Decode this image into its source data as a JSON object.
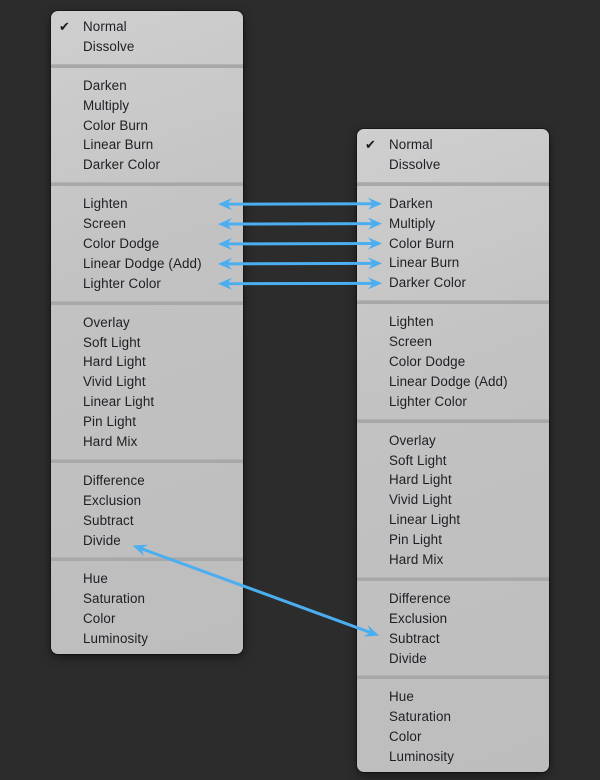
{
  "accent_color": "#4aaef0",
  "menus": [
    {
      "id": "left",
      "checked_item": "Normal",
      "groups": [
        [
          "Normal",
          "Dissolve"
        ],
        [
          "Darken",
          "Multiply",
          "Color Burn",
          "Linear Burn",
          "Darker Color"
        ],
        [
          "Lighten",
          "Screen",
          "Color Dodge",
          "Linear Dodge (Add)",
          "Lighter Color"
        ],
        [
          "Overlay",
          "Soft Light",
          "Hard Light",
          "Vivid Light",
          "Linear Light",
          "Pin Light",
          "Hard Mix"
        ],
        [
          "Difference",
          "Exclusion",
          "Subtract",
          "Divide"
        ],
        [
          "Hue",
          "Saturation",
          "Color",
          "Luminosity"
        ]
      ]
    },
    {
      "id": "right",
      "checked_item": "Normal",
      "groups": [
        [
          "Normal",
          "Dissolve"
        ],
        [
          "Darken",
          "Multiply",
          "Color Burn",
          "Linear Burn",
          "Darker Color"
        ],
        [
          "Lighten",
          "Screen",
          "Color Dodge",
          "Linear Dodge (Add)",
          "Lighter Color"
        ],
        [
          "Overlay",
          "Soft Light",
          "Hard Light",
          "Vivid Light",
          "Linear Light",
          "Pin Light",
          "Hard Mix"
        ],
        [
          "Difference",
          "Exclusion",
          "Subtract",
          "Divide"
        ],
        [
          "Hue",
          "Saturation",
          "Color",
          "Luminosity"
        ]
      ]
    }
  ],
  "mappings": [
    {
      "from": "Lighten",
      "to": "Darken",
      "style": "double-headed"
    },
    {
      "from": "Screen",
      "to": "Multiply",
      "style": "double-headed"
    },
    {
      "from": "Color Dodge",
      "to": "Color Burn",
      "style": "double-headed"
    },
    {
      "from": "Linear Dodge (Add)",
      "to": "Linear Burn",
      "style": "double-headed"
    },
    {
      "from": "Lighter Color",
      "to": "Darker Color",
      "style": "double-headed"
    },
    {
      "from": "Divide",
      "to": "Subtract",
      "style": "double-headed"
    }
  ]
}
